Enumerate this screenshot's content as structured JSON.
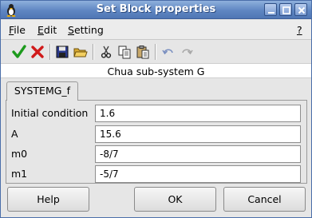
{
  "window": {
    "title": "Set Block properties",
    "title_bar_color": "#5f86c2"
  },
  "menubar": {
    "file": {
      "accel": "F",
      "rest": "ile"
    },
    "edit": {
      "accel": "E",
      "rest": "dit"
    },
    "setting": {
      "accel": "S",
      "rest": "etting"
    },
    "help": {
      "accel": "?",
      "rest": ""
    }
  },
  "toolbar": {
    "icons": [
      "ok-check-icon",
      "cancel-x-icon",
      "save-icon",
      "open-folder-icon",
      "cut-icon",
      "copy-icon",
      "paste-icon",
      "undo-icon",
      "redo-icon"
    ]
  },
  "subtitle": "Chua sub-system G",
  "tab": {
    "label": "SYSTEMG_f"
  },
  "fields": [
    {
      "label": "Initial condition",
      "value": "1.6"
    },
    {
      "label": "A",
      "value": "15.6"
    },
    {
      "label": "m0",
      "value": "-8/7"
    },
    {
      "label": "m1",
      "value": "-5/7"
    }
  ],
  "buttons": {
    "help": "Help",
    "ok": "OK",
    "cancel": "Cancel"
  },
  "colors": {
    "accept_green": "#1d9a1d",
    "cancel_red": "#d01a1a"
  }
}
